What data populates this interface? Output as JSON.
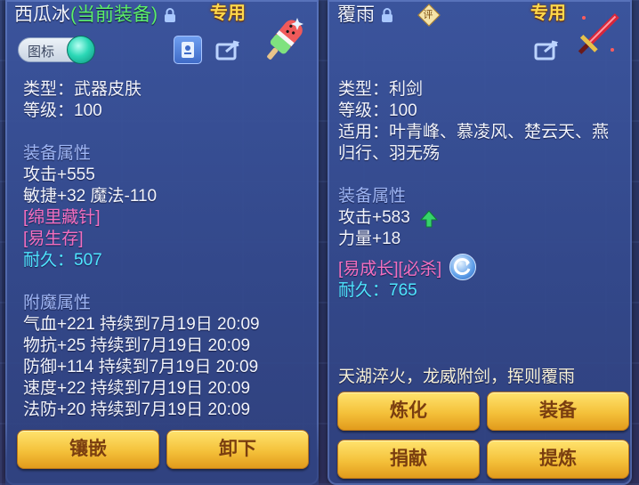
{
  "left_panel": {
    "title_name": "西瓜冰",
    "title_status": "(当前装备)",
    "special_label": "专用",
    "tag_label": "图标",
    "lines": {
      "type": "类型：武器皮肤",
      "level": "等级：100",
      "equip_attr_header": "装备属性",
      "attack": "攻击+555",
      "agility_magic": "敏捷+32 魔法-110",
      "effect1": "[绵里藏针]",
      "effect2": "[易生存]",
      "durability": "耐久：507",
      "enchant_header": "附魔属性",
      "enchant1": "气血+221 持续到7月19日 20:09",
      "enchant2": "物抗+25 持续到7月19日 20:09",
      "enchant3": "防御+114 持续到7月19日 20:09",
      "enchant4": "速度+22 持续到7月19日 20:09",
      "enchant5": "法防+20 持续到7月19日 20:09"
    },
    "buttons": {
      "inlay": "镶嵌",
      "unequip": "卸下"
    }
  },
  "right_panel": {
    "title_name": "覆雨",
    "rating_badge": "评",
    "special_label": "专用",
    "lines": {
      "type": "类型：利剑",
      "level": "等级：100",
      "suitable1": "适用：叶青峰、慕凌风、楚云天、燕",
      "suitable2": "归行、羽无殇",
      "equip_attr_header": "装备属性",
      "attack": "攻击+583",
      "strength": "力量+18",
      "effects": "[易成长][必杀]",
      "durability": "耐久：765",
      "flavor": "天湖淬火，龙威附剑，挥则覆雨"
    },
    "buttons": {
      "refine": "炼化",
      "equip": "装备",
      "donate": "捐献",
      "extract": "提炼"
    }
  },
  "colors": {
    "panel_bg": "#3c56a0",
    "header_text": "#9fb6f4",
    "effect_pink": "#f46fbf",
    "durability_cyan": "#4fe6ff",
    "status_green": "#5cf06a",
    "special_gold": "#ffd84a",
    "button_gold": "#f4c13a",
    "button_text": "#7a3e10"
  },
  "icons": [
    "lock-icon",
    "popsicle-item-icon",
    "id-card-icon",
    "share-icon",
    "rating-badge-icon",
    "sword-item-icon",
    "upgrade-arrow-icon",
    "refresh-cycle-icon"
  ]
}
